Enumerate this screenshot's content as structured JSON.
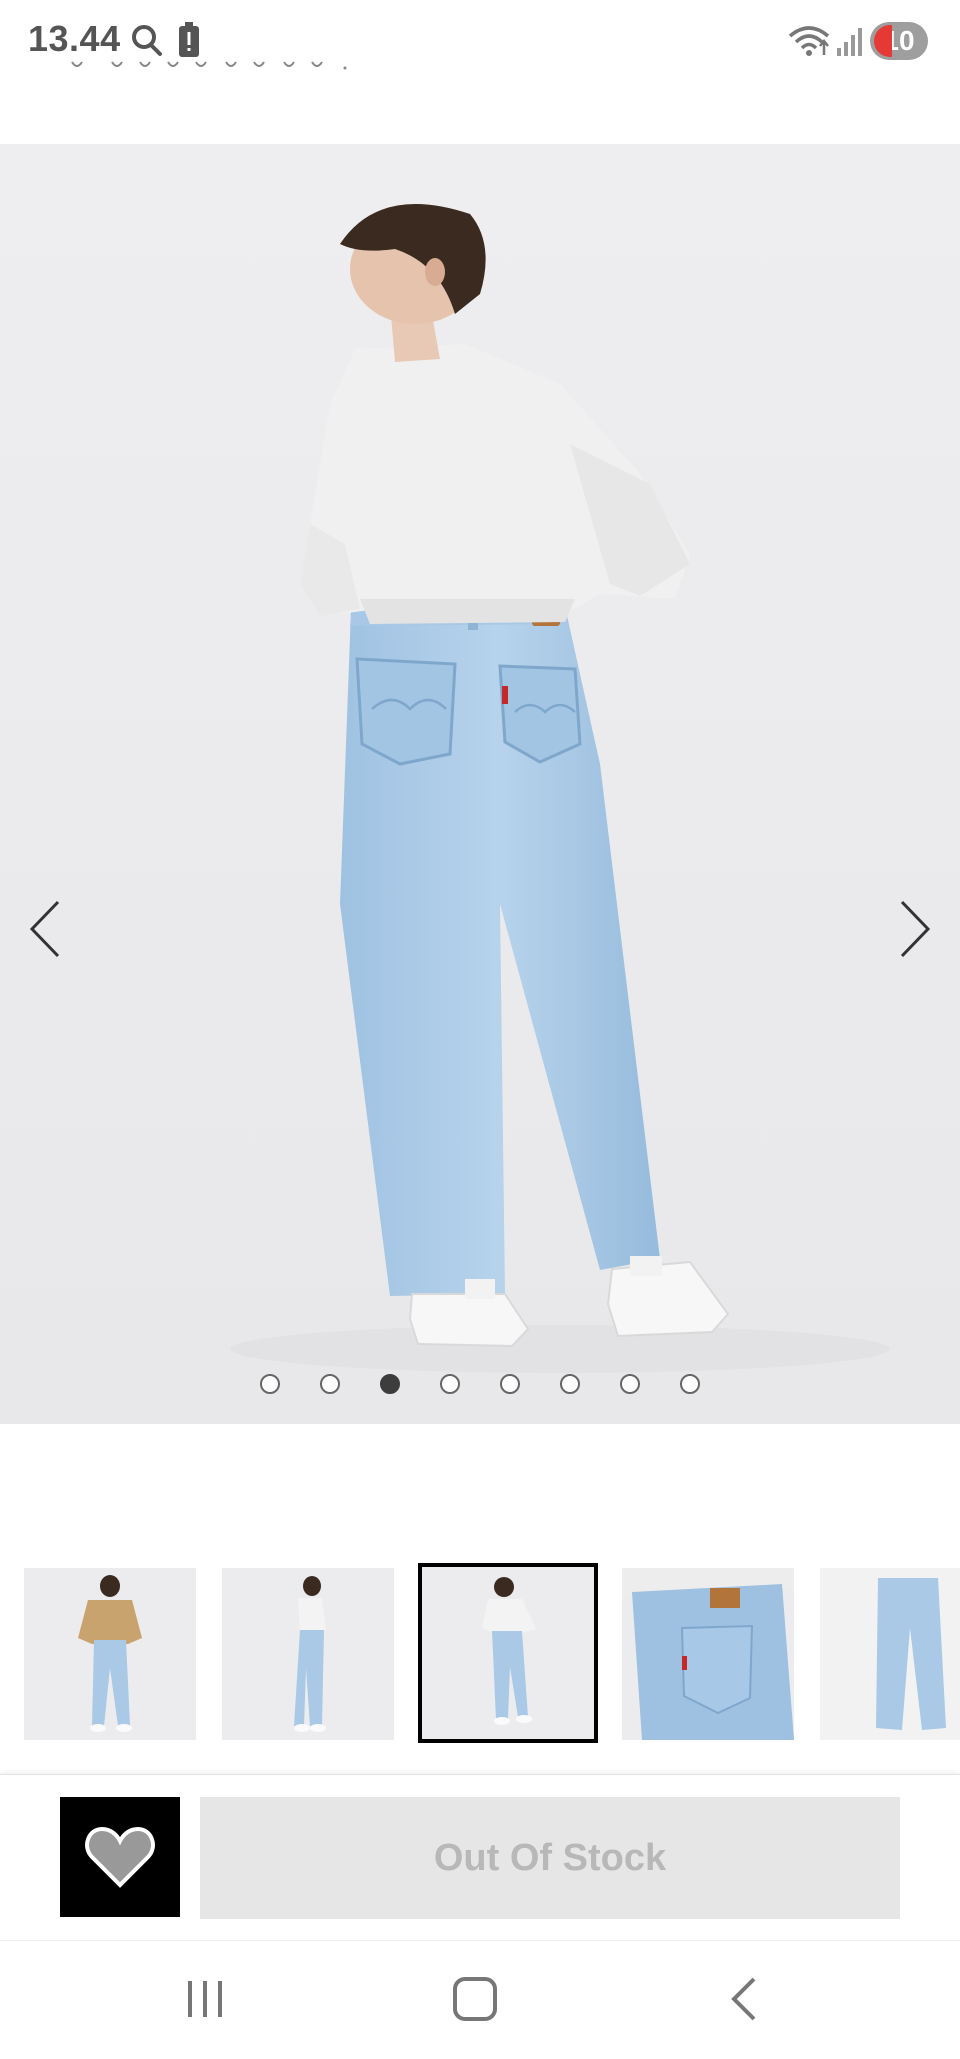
{
  "status_bar": {
    "time": "13.44",
    "notification_count": "10",
    "icons": [
      "search-icon",
      "battery-alert-icon",
      "wifi-icon",
      "signal-icon"
    ]
  },
  "gallery": {
    "image_count": 8,
    "active_index": 2,
    "main_image": "product-photo-back-view-wide-leg-jeans",
    "thumbnails": [
      {
        "icon": "thumbnail-front-jacket"
      },
      {
        "icon": "thumbnail-side-view"
      },
      {
        "icon": "thumbnail-back-view"
      },
      {
        "icon": "thumbnail-back-pocket-detail"
      },
      {
        "icon": "thumbnail-flat-lay"
      }
    ]
  },
  "actions": {
    "wishlist_icon": "heart-icon",
    "stock_label": "Out Of Stock"
  },
  "system_nav": {
    "icons": [
      "recent-apps-icon",
      "home-icon",
      "back-icon"
    ]
  },
  "colors": {
    "photo_bg": "#ececee",
    "denim": "#a9c9e6",
    "button_disabled_bg": "#e6e6e6",
    "button_disabled_text": "#b8b8b8",
    "wishlist_bg": "#000000"
  }
}
